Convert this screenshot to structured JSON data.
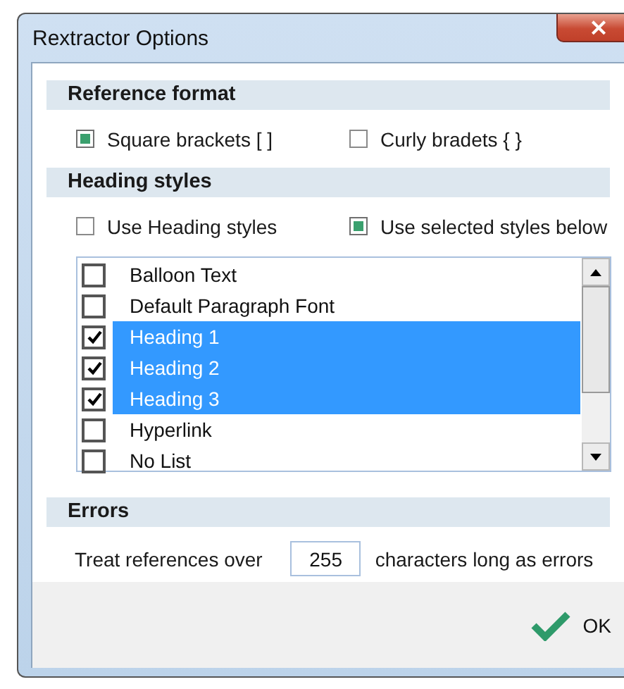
{
  "window": {
    "title": "Rextractor Options",
    "close": "×"
  },
  "reference_format": {
    "title": "Reference format",
    "options": [
      {
        "label": "Square brackets [ ]",
        "checked": true
      },
      {
        "label": "Curly bradets { }",
        "checked": false
      }
    ]
  },
  "heading_styles": {
    "title": "Heading styles",
    "options": [
      {
        "label": "Use Heading styles",
        "checked": false
      },
      {
        "label": "Use selected styles below",
        "checked": true
      }
    ],
    "styles": [
      {
        "label": "Balloon Text",
        "checked": false,
        "selected": false
      },
      {
        "label": "Default Paragraph Font",
        "checked": false,
        "selected": false
      },
      {
        "label": "Heading 1",
        "checked": true,
        "selected": true
      },
      {
        "label": "Heading 2",
        "checked": true,
        "selected": true
      },
      {
        "label": "Heading 3",
        "checked": true,
        "selected": true
      },
      {
        "label": "Hyperlink",
        "checked": false,
        "selected": false
      },
      {
        "label": "No List",
        "checked": false,
        "selected": false
      }
    ]
  },
  "errors": {
    "title": "Errors",
    "prefix": "Treat references over",
    "value": "255",
    "suffix": "characters long as errors"
  },
  "buttons": [
    {
      "label": "OK"
    }
  ]
}
